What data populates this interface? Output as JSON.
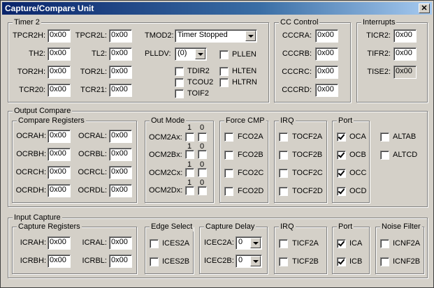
{
  "window": {
    "title": "Capture/Compare Unit",
    "close_glyph": "✕"
  },
  "timer2": {
    "title": "Timer 2",
    "tpcr2h": {
      "label": "TPCR2H:",
      "value": "0x00"
    },
    "tpcr2l": {
      "label": "TPCR2L:",
      "value": "0x00"
    },
    "th2": {
      "label": "TH2:",
      "value": "0x00"
    },
    "tl2": {
      "label": "TL2:",
      "value": "0x00"
    },
    "tor2h": {
      "label": "TOR2H:",
      "value": "0x00"
    },
    "tor2l": {
      "label": "TOR2L:",
      "value": "0x00"
    },
    "tcr20": {
      "label": "TCR20:",
      "value": "0x00"
    },
    "tcr21": {
      "label": "TCR21:",
      "value": "0x00"
    },
    "tmod2": {
      "label": "TMOD2:",
      "value": "Timer Stopped"
    },
    "plldv": {
      "label": "PLLDV:",
      "value": "(0)"
    },
    "pllen": {
      "label": "PLLEN",
      "checked": false
    },
    "tdir2": {
      "label": "TDIR2",
      "checked": false
    },
    "hlten": {
      "label": "HLTEN",
      "checked": false
    },
    "tcou2": {
      "label": "TCOU2",
      "checked": false
    },
    "hltrn": {
      "label": "HLTRN",
      "checked": false
    },
    "toif2": {
      "label": "TOIF2",
      "checked": false
    }
  },
  "cc_control": {
    "title": "CC Control",
    "cccra": {
      "label": "CCCRA:",
      "value": "0x00"
    },
    "cccrb": {
      "label": "CCCRB:",
      "value": "0x00"
    },
    "cccrc": {
      "label": "CCCRC:",
      "value": "0x00"
    },
    "cccrd": {
      "label": "CCCRD:",
      "value": "0x00"
    }
  },
  "interrupts": {
    "title": "Interrupts",
    "ticr2": {
      "label": "TICR2:",
      "value": "0x00"
    },
    "tifr2": {
      "label": "TIFR2:",
      "value": "0x00"
    },
    "tise2": {
      "label": "TISE2:",
      "value": "0x00"
    }
  },
  "output_compare": {
    "title": "Output Compare",
    "registers": {
      "title": "Compare Registers",
      "ocrah": {
        "label": "OCRAH:",
        "value": "0x00"
      },
      "ocral": {
        "label": "OCRAL:",
        "value": "0x00"
      },
      "ocrbh": {
        "label": "OCRBH:",
        "value": "0x00"
      },
      "ocrbl": {
        "label": "OCRBL:",
        "value": "0x00"
      },
      "ocrch": {
        "label": "OCRCH:",
        "value": "0x00"
      },
      "ocrcl": {
        "label": "OCRCL:",
        "value": "0x00"
      },
      "ocrdh": {
        "label": "OCRDH:",
        "value": "0x00"
      },
      "ocrdl": {
        "label": "OCRDL:",
        "value": "0x00"
      }
    },
    "out_mode": {
      "title": "Out Mode",
      "bit1": "1",
      "bit0": "0",
      "rows": [
        "OCM2Ax:",
        "OCM2Bx:",
        "OCM2Cx:",
        "OCM2Dx:"
      ]
    },
    "force_cmp": {
      "title": "Force CMP",
      "items": [
        "FCO2A",
        "FCO2B",
        "FCO2C",
        "FCO2D"
      ]
    },
    "irq": {
      "title": "IRQ",
      "items": [
        "TOCF2A",
        "TOCF2B",
        "TOCF2C",
        "TOCF2D"
      ]
    },
    "port": {
      "title": "Port",
      "items": [
        {
          "label": "OCA",
          "checked": true
        },
        {
          "label": "OCB",
          "checked": true
        },
        {
          "label": "OCC",
          "checked": true
        },
        {
          "label": "OCD",
          "checked": true
        }
      ],
      "altab": {
        "label": "ALTAB",
        "checked": false
      },
      "altcd": {
        "label": "ALTCD",
        "checked": false
      }
    }
  },
  "input_capture": {
    "title": "Input Capture",
    "registers": {
      "title": "Capture Registers",
      "icrah": {
        "label": "ICRAH:",
        "value": "0x00"
      },
      "icral": {
        "label": "ICRAL:",
        "value": "0x00"
      },
      "icrbh": {
        "label": "ICRBH:",
        "value": "0x00"
      },
      "icrbl": {
        "label": "ICRBL:",
        "value": "0x00"
      }
    },
    "edge_select": {
      "title": "Edge Select",
      "items": [
        "ICES2A",
        "ICES2B"
      ]
    },
    "capture_delay": {
      "title": "Capture Delay",
      "icec2a": {
        "label": "ICEC2A:",
        "value": "0"
      },
      "icec2b": {
        "label": "ICEC2B:",
        "value": "0"
      }
    },
    "irq": {
      "title": "IRQ",
      "items": [
        "TICF2A",
        "TICF2B"
      ]
    },
    "port": {
      "title": "Port",
      "items": [
        {
          "label": "ICA",
          "checked": true
        },
        {
          "label": "ICB",
          "checked": true
        }
      ]
    },
    "noise_filter": {
      "title": "Noise Filter",
      "items": [
        "ICNF2A",
        "ICNF2B"
      ]
    }
  }
}
